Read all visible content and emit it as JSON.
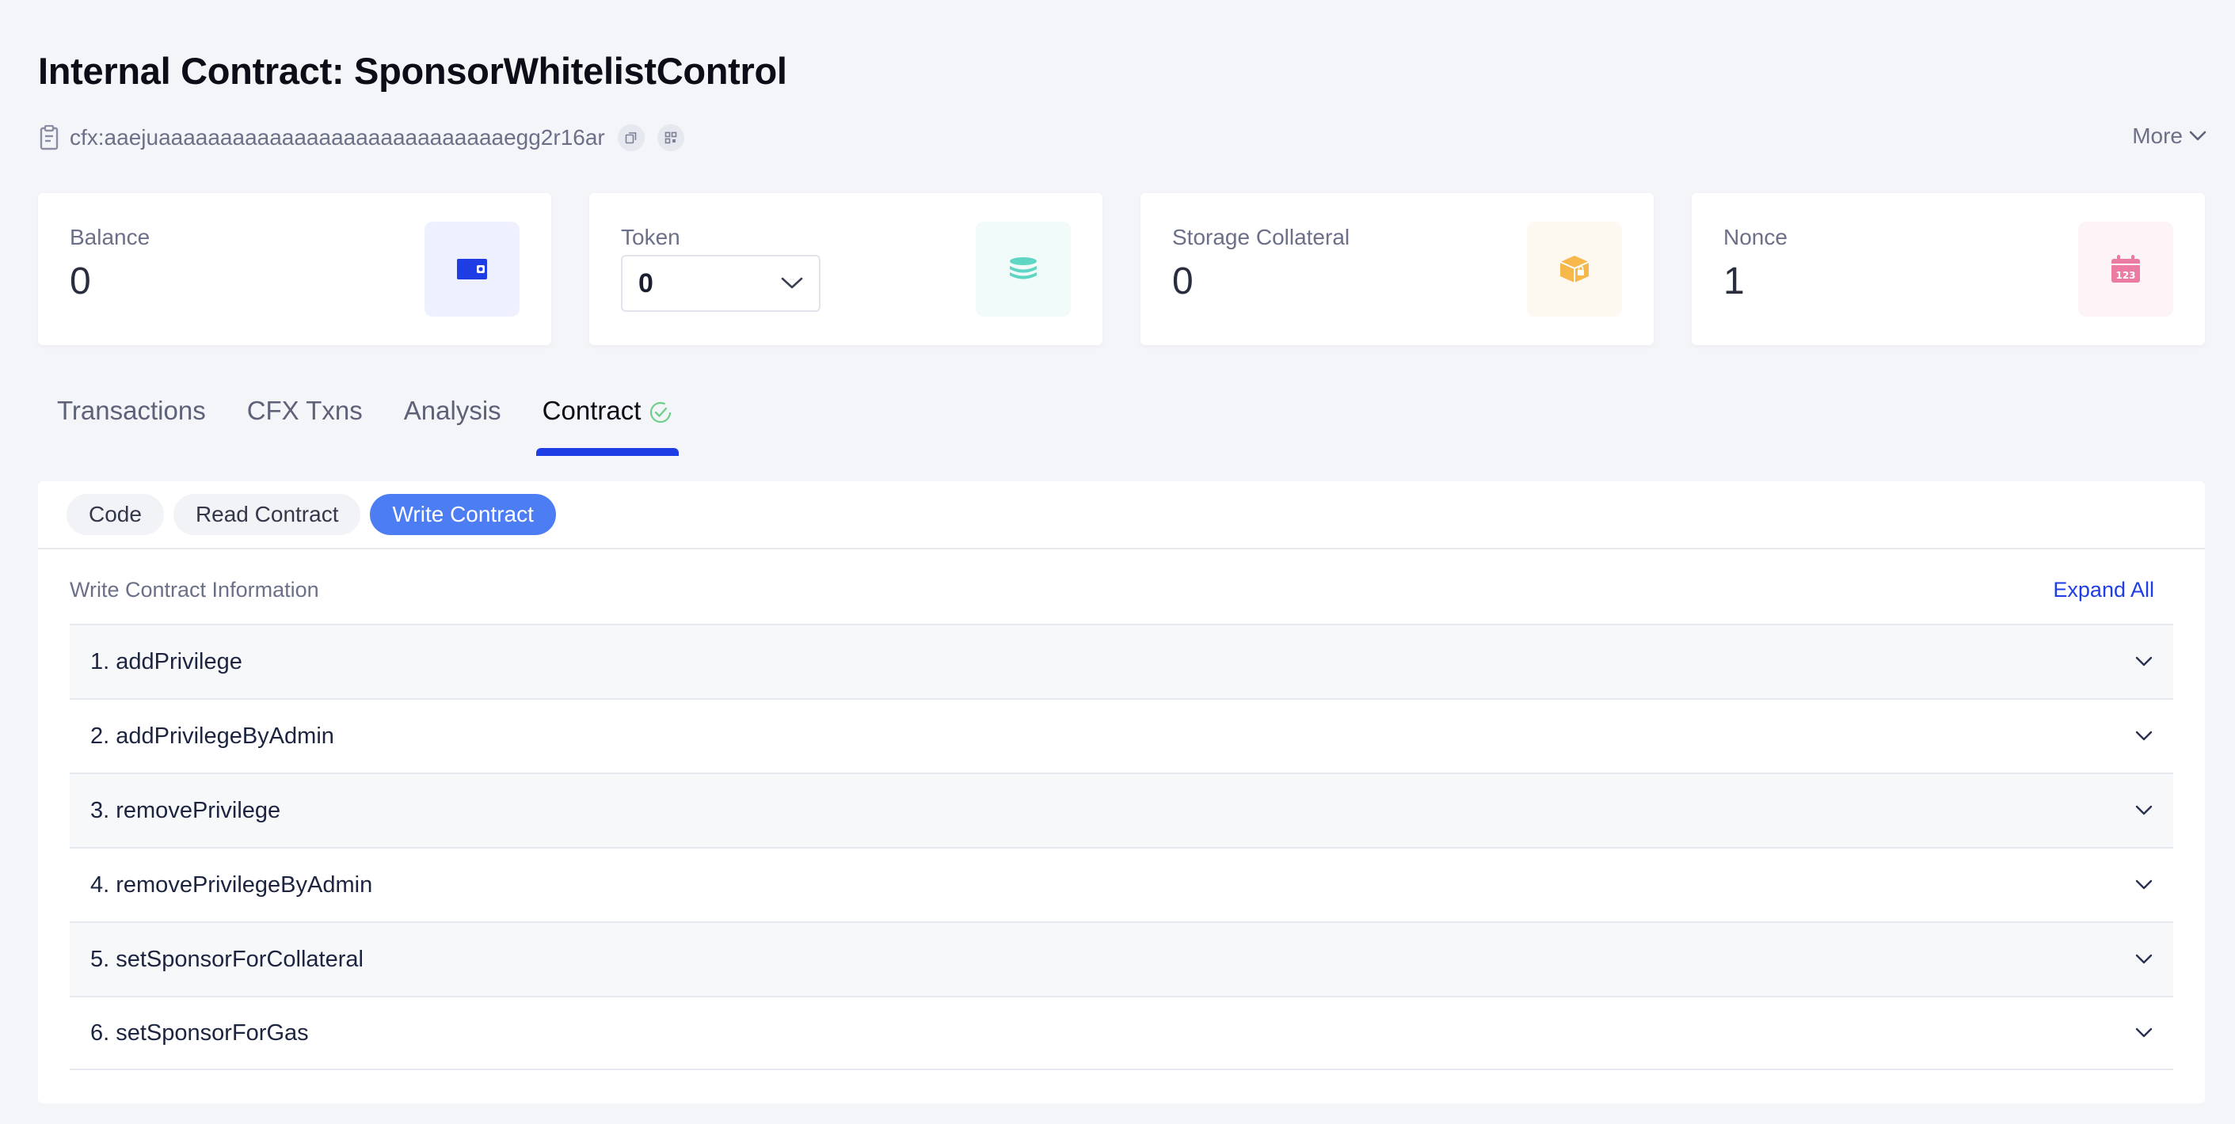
{
  "header": {
    "title": "Internal Contract: SponsorWhitelistControl",
    "address": "cfx:aaejuaaaaaaaaaaaaaaaaaaaaaaaaaaaaegg2r16ar",
    "more_label": "More"
  },
  "cards": {
    "balance": {
      "label": "Balance",
      "value": "0"
    },
    "token": {
      "label": "Token",
      "value": "0"
    },
    "storage": {
      "label": "Storage Collateral",
      "value": "0"
    },
    "nonce": {
      "label": "Nonce",
      "value": "1"
    }
  },
  "tabs": [
    {
      "label": "Transactions"
    },
    {
      "label": "CFX Txns"
    },
    {
      "label": "Analysis"
    },
    {
      "label": "Contract",
      "active": true
    }
  ],
  "subtabs": [
    {
      "label": "Code"
    },
    {
      "label": "Read Contract"
    },
    {
      "label": "Write Contract",
      "active": true
    }
  ],
  "write": {
    "info_label": "Write Contract Information",
    "expand_all": "Expand All",
    "functions": [
      "1. addPrivilege",
      "2. addPrivilegeByAdmin",
      "3. removePrivilege",
      "4. removePrivilegeByAdmin",
      "5. setSponsorForCollateral",
      "6. setSponsorForGas"
    ]
  },
  "colors": {
    "accent": "#1e3de4",
    "pill_active": "#4d7df2",
    "balance_icon": "#1e3de4",
    "token_icon": "#5ed6c3",
    "storage_icon": "#f6b84a",
    "nonce_icon": "#ec7ba3"
  },
  "icons": {
    "balance": "wallet-icon",
    "token": "coin-stack-icon",
    "storage": "box-icon",
    "nonce": "calendar-icon"
  }
}
